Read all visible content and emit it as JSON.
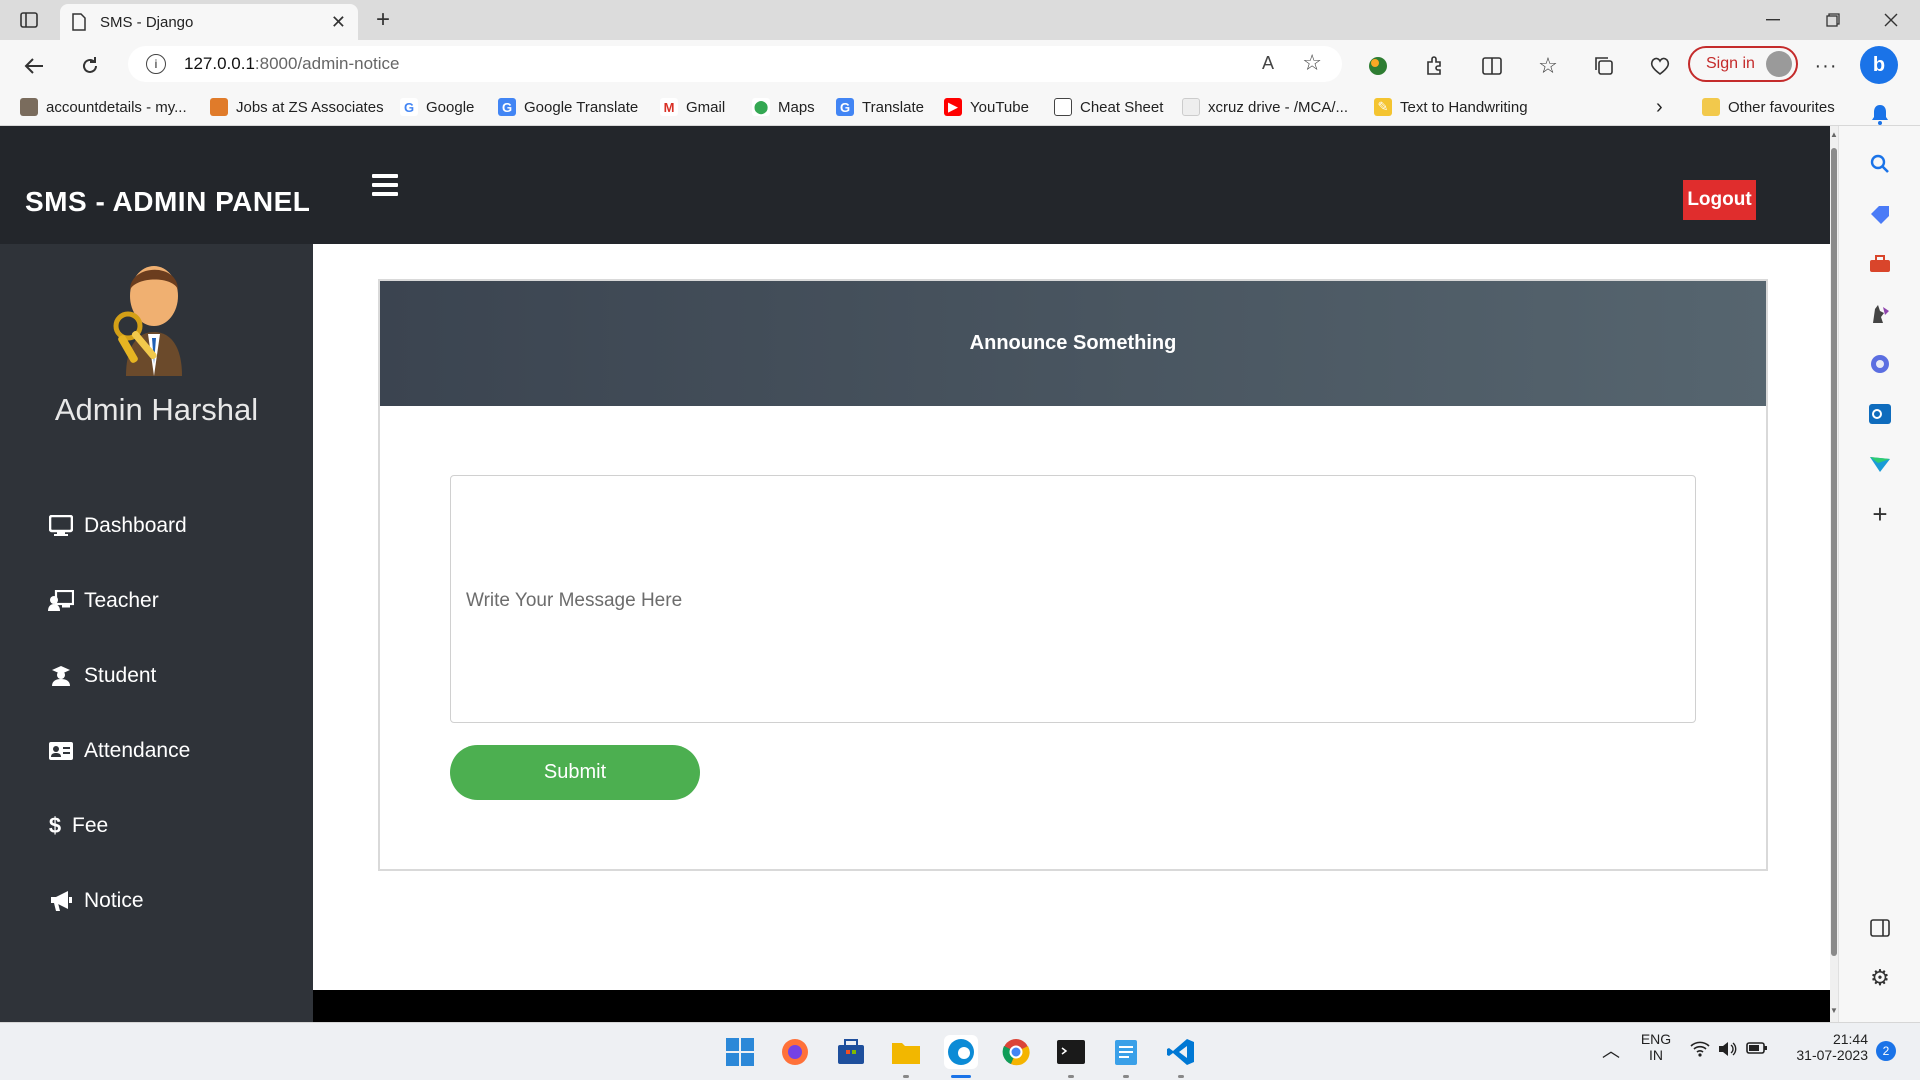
{
  "browser": {
    "tab_title": "SMS - Django",
    "url_host": "127.0.0.1",
    "url_path": ":8000/admin-notice",
    "signin_label": "Sign in",
    "bookmarks": [
      {
        "label": "accountdetails - my...",
        "icon": "account-icon"
      },
      {
        "label": "Jobs at ZS Associates",
        "icon": "zs-icon"
      },
      {
        "label": "Google",
        "icon": "google-icon"
      },
      {
        "label": "Google Translate",
        "icon": "translate-icon"
      },
      {
        "label": "Gmail",
        "icon": "gmail-icon"
      },
      {
        "label": "Maps",
        "icon": "maps-icon"
      },
      {
        "label": "Translate",
        "icon": "translate-icon"
      },
      {
        "label": "YouTube",
        "icon": "youtube-icon"
      },
      {
        "label": "Cheat Sheet",
        "icon": "page-icon"
      },
      {
        "label": "xcruz drive - /MCA/...",
        "icon": "drive-icon"
      },
      {
        "label": "Text to Handwriting",
        "icon": "pen-icon"
      }
    ],
    "other_favourites": "Other favourites"
  },
  "app": {
    "brand": "SMS - ADMIN PANEL",
    "logout_label": "Logout",
    "admin_name": "Admin Harshal",
    "menu": [
      {
        "label": "Dashboard",
        "icon": "monitor-icon"
      },
      {
        "label": "Teacher",
        "icon": "teacher-icon"
      },
      {
        "label": "Student",
        "icon": "student-icon"
      },
      {
        "label": "Attendance",
        "icon": "id-card-icon"
      },
      {
        "label": "Fee",
        "icon": "dollar-icon"
      },
      {
        "label": "Notice",
        "icon": "megaphone-icon"
      }
    ],
    "notice": {
      "heading": "Announce Something",
      "message_placeholder": "Write Your Message Here",
      "message_value": "",
      "submit_label": "Submit"
    }
  },
  "taskbar": {
    "lang": "ENG",
    "region": "IN",
    "time": "21:44",
    "date": "31-07-2023",
    "notifications": "2"
  },
  "colors": {
    "header_bg": "#23262b",
    "sidebar_bg": "#2f3339",
    "logout": "#e02d2d",
    "submit": "#4caf50",
    "card_header_start": "#3b4450",
    "card_header_end": "#56656f"
  }
}
